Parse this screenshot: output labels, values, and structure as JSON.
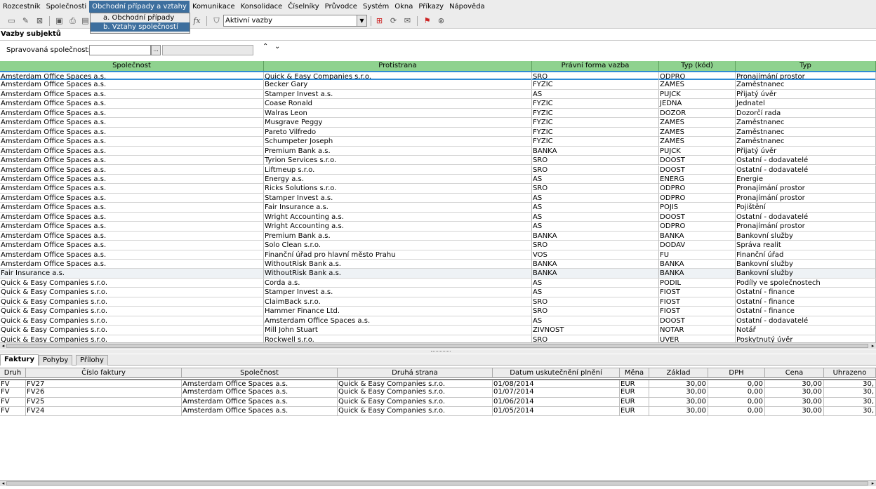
{
  "menubar": {
    "items": [
      {
        "label": "Rozcestník",
        "active": false
      },
      {
        "label": "Společnosti",
        "active": false
      },
      {
        "label": "Obchodní případy a vztahy",
        "active": true
      },
      {
        "label": "Komunikace",
        "active": false
      },
      {
        "label": "Konsolidace",
        "active": false
      },
      {
        "label": "Číselníky",
        "active": false
      },
      {
        "label": "Průvodce",
        "active": false
      },
      {
        "label": "Systém",
        "active": false
      },
      {
        "label": "Okna",
        "active": false
      },
      {
        "label": "Příkazy",
        "active": false
      },
      {
        "label": "Nápověda",
        "active": false
      }
    ]
  },
  "dropdown": {
    "items": [
      {
        "label": "a. Obchodní případy",
        "selected": false
      },
      {
        "label": "b. Vztahy společností",
        "selected": true
      }
    ]
  },
  "toolbar": {
    "icons": [
      "new-icon",
      "edit-icon",
      "delete-icon",
      "save-icon",
      "print-icon",
      "formula-icon",
      "filter-icon",
      "close-filter-icon",
      "refresh-icon",
      "comment-icon",
      "flag-cz-icon",
      "close-icon"
    ],
    "formula_label": "fx",
    "filter_value": "Aktivní vazby"
  },
  "panel": {
    "title": "Vazby subjektů",
    "filter_label": "Spravovaná společnost:",
    "filter_value": "",
    "browse_label": "...",
    "collapse_up": "⌃",
    "collapse_down": "⌄"
  },
  "main_grid": {
    "columns": [
      "Společnost",
      "Protistrana",
      "Právní forma vazba",
      "Typ (kód)",
      "Typ"
    ],
    "rows": [
      [
        "Amsterdam Office Spaces a.s.",
        "Quick & Easy Companies s.r.o.",
        "SRO",
        "ODPRO",
        "Pronajímání prostor"
      ],
      [
        "Amsterdam Office Spaces a.s.",
        "Becker Gary",
        "FYZIC",
        "ZAMES",
        "Zaměstnanec"
      ],
      [
        "Amsterdam Office Spaces a.s.",
        "Stamper Invest a.s.",
        "AS",
        "PUJCK",
        "Přijatý úvěr"
      ],
      [
        "Amsterdam Office Spaces a.s.",
        "Coase Ronald",
        "FYZIC",
        "JEDNA",
        "Jednatel"
      ],
      [
        "Amsterdam Office Spaces a.s.",
        "Walras Leon",
        "FYZIC",
        "DOZOR",
        "Dozorčí rada"
      ],
      [
        "Amsterdam Office Spaces a.s.",
        "Musgrave Peggy",
        "FYZIC",
        "ZAMES",
        "Zaměstnanec"
      ],
      [
        "Amsterdam Office Spaces a.s.",
        "Pareto Vilfredo",
        "FYZIC",
        "ZAMES",
        "Zaměstnanec"
      ],
      [
        "Amsterdam Office Spaces a.s.",
        "Schumpeter Joseph",
        "FYZIC",
        "ZAMES",
        "Zaměstnanec"
      ],
      [
        "Amsterdam Office Spaces a.s.",
        "Premium Bank a.s.",
        "BANKA",
        "PUJCK",
        "Přijatý úvěr"
      ],
      [
        "Amsterdam Office Spaces a.s.",
        "Tyrion Services s.r.o.",
        "SRO",
        "DOOST",
        "Ostatní - dodavatelé"
      ],
      [
        "Amsterdam Office Spaces a.s.",
        "Liftmeup s.r.o.",
        "SRO",
        "DOOST",
        "Ostatní - dodavatelé"
      ],
      [
        "Amsterdam Office Spaces a.s.",
        "Energy a.s.",
        "AS",
        "ENERG",
        "Energie"
      ],
      [
        "Amsterdam Office Spaces a.s.",
        "Ricks Solutions s.r.o.",
        "SRO",
        "ODPRO",
        "Pronajímání prostor"
      ],
      [
        "Amsterdam Office Spaces a.s.",
        "Stamper Invest a.s.",
        "AS",
        "ODPRO",
        "Pronajímání prostor"
      ],
      [
        "Amsterdam Office Spaces a.s.",
        "Fair Insurance a.s.",
        "AS",
        "POJIS",
        "Pojištění"
      ],
      [
        "Amsterdam Office Spaces a.s.",
        "Wright Accounting a.s.",
        "AS",
        "DOOST",
        "Ostatní - dodavatelé"
      ],
      [
        "Amsterdam Office Spaces a.s.",
        "Wright Accounting a.s.",
        "AS",
        "ODPRO",
        "Pronajímání prostor"
      ],
      [
        "Amsterdam Office Spaces a.s.",
        "Premium Bank a.s.",
        "BANKA",
        "BANKA",
        "Bankovní služby"
      ],
      [
        "Amsterdam Office Spaces a.s.",
        "Solo Clean s.r.o.",
        "SRO",
        "DODAV",
        "Správa realit"
      ],
      [
        "Amsterdam Office Spaces a.s.",
        "Finanční úřad pro hlavní město Prahu",
        "VOS",
        "FU",
        "Finanční úřad"
      ],
      [
        "Amsterdam Office Spaces a.s.",
        "WithoutRisk Bank a.s.",
        "BANKA",
        "BANKA",
        "Bankovní služby"
      ],
      [
        "Fair Insurance a.s.",
        "WithoutRisk Bank a.s.",
        "BANKA",
        "BANKA",
        "Bankovní služby"
      ],
      [
        "Quick & Easy Companies s.r.o.",
        "Corda a.s.",
        "AS",
        "PODIL",
        "Podíly ve společnostech"
      ],
      [
        "Quick & Easy Companies s.r.o.",
        "Stamper Invest a.s.",
        "AS",
        "FIOST",
        "Ostatní - finance"
      ],
      [
        "Quick & Easy Companies s.r.o.",
        "ClaimBack s.r.o.",
        "SRO",
        "FIOST",
        "Ostatní - finance"
      ],
      [
        "Quick & Easy Companies s.r.o.",
        "Hammer Finance Ltd.",
        "SRO",
        "FIOST",
        "Ostatní - finance"
      ],
      [
        "Quick & Easy Companies s.r.o.",
        "Amsterdam Office Spaces a.s.",
        "AS",
        "DOOST",
        "Ostatní - dodavatelé"
      ],
      [
        "Quick & Easy Companies s.r.o.",
        "Mill John Stuart",
        "ZIVNOST",
        "NOTAR",
        "Notář"
      ],
      [
        "Quick & Easy Companies s.r.o.",
        "Rockwell s.r.o.",
        "SRO",
        "UVER",
        "Poskytnutý úvěr"
      ]
    ]
  },
  "tabs": [
    {
      "label": "Faktury",
      "active": true
    },
    {
      "label": "Pohyby",
      "active": false
    },
    {
      "label": "Přílohy",
      "active": false
    }
  ],
  "bottom_grid": {
    "columns": [
      "Druh",
      "Číslo faktury",
      "Společnost",
      "Druhá strana",
      "Datum uskutečnění plnění",
      "Měna",
      "Základ",
      "DPH",
      "Cena",
      "Uhrazeno"
    ],
    "rows": [
      [
        "FV",
        "FV27",
        "Amsterdam Office Spaces a.s.",
        "Quick & Easy Companies s.r.o.",
        "01/08/2014",
        "EUR",
        "30,00",
        "0,00",
        "30,00",
        "30,"
      ],
      [
        "FV",
        "FV26",
        "Amsterdam Office Spaces a.s.",
        "Quick & Easy Companies s.r.o.",
        "01/07/2014",
        "EUR",
        "30,00",
        "0,00",
        "30,00",
        "30,"
      ],
      [
        "FV",
        "FV25",
        "Amsterdam Office Spaces a.s.",
        "Quick & Easy Companies s.r.o.",
        "01/06/2014",
        "EUR",
        "30,00",
        "0,00",
        "30,00",
        "30,"
      ],
      [
        "FV",
        "FV24",
        "Amsterdam Office Spaces a.s.",
        "Quick & Easy Companies s.r.o.",
        "01/05/2014",
        "EUR",
        "30,00",
        "0,00",
        "30,00",
        "30,"
      ]
    ]
  },
  "colors": {
    "menu_active": "#3d6f9e",
    "grid_header": "#8fd28f",
    "selection_border": "#2f8bd5"
  }
}
